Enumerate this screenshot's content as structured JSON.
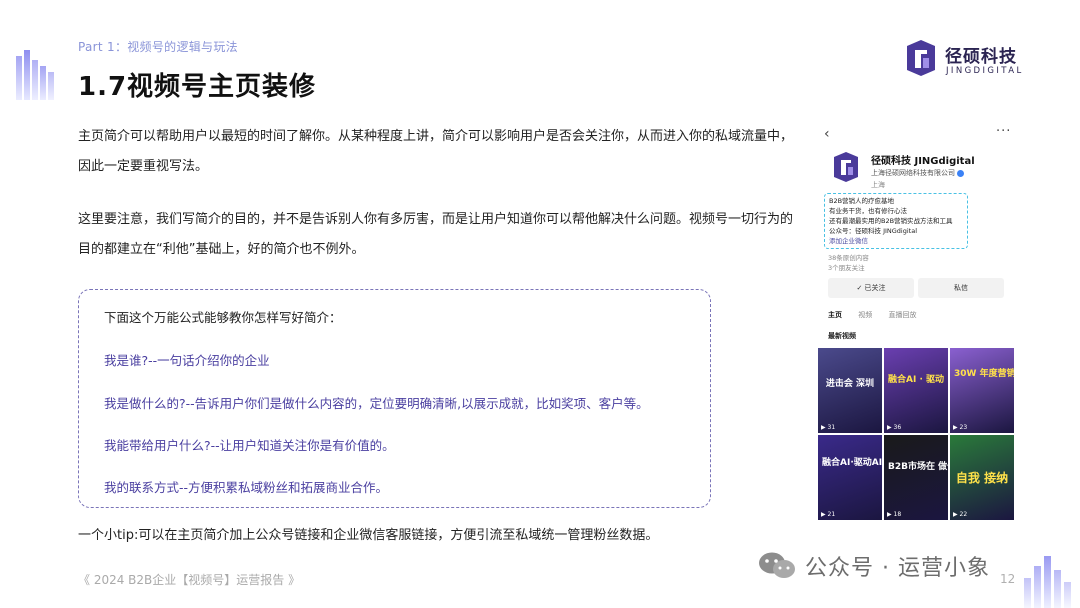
{
  "header": {
    "part_label": "Part 1：视频号的逻辑与玩法",
    "title": "1.7视频号主页装修"
  },
  "logo": {
    "name_cn": "径硕科技",
    "name_en": "JINGDIGITAL",
    "color": "#2b2452"
  },
  "body": {
    "paragraph1": "主页简介可以帮助用户以最短的时间了解你。从某种程度上讲，简介可以影响用户是否会关注你，从而进入你的私域流量中，因此一定要重视写法。",
    "paragraph2": "这里要注意，我们写简介的目的，并不是告诉别人你有多厉害，而是让用户知道你可以帮他解决什么问题。视频号一切行为的目的都建立在“利他”基础上，好的简介也不例外。"
  },
  "formula": {
    "intro": "下面这个万能公式能够教你怎样写好简介：",
    "items": [
      "我是谁?--一句话介绍你的企业",
      "我是做什么的?--告诉用户你们是做什么内容的，定位要明确清晰,以展示成就，比如奖项、客户等。",
      "我能带给用户什么?--让用户知道关注你是有价值的。",
      "我的联系方式--方便积累私域粉丝和拓展商业合作。"
    ],
    "accent_color": "#4a3fa0"
  },
  "tip": "一个小tip:可以在主页简介加上公众号链接和企业微信客服链接，方便引流至私域统一管理粉丝数据。",
  "footer": {
    "report_name": "《 2024 B2B企业【视频号】运营报告 》",
    "page_number": "12"
  },
  "watermark": {
    "text": "公众号 · 运营小象"
  },
  "phone": {
    "back_icon": "‹",
    "more_icon": "···",
    "account_name": "径硕科技 JINGdigital",
    "company": "上海径硕网络科技有限公司",
    "location": "上海",
    "bio_lines": [
      "B2B营销人的疗愈基地",
      "有业务干货，也有修行心法",
      "还有最潮最实用的B2B营销实战方法和工具",
      "公众号：径硕科技 JINGdigital",
      "添加企业微信"
    ],
    "stats": [
      "38条原创内容",
      "3个朋友关注"
    ],
    "follow_button": "✓ 已关注",
    "message_button": "私信",
    "tabs": [
      "主页",
      "视频",
      "直播回放"
    ],
    "section_title": "最新视频",
    "tiles": [
      {
        "text": "进击会 深圳",
        "count": "▶ 31",
        "bg": "#4b4a8c",
        "fg": "#ffffff"
      },
      {
        "text": "融合AI · 驱动",
        "count": "▶ 36",
        "bg": "#6a3fb0",
        "fg": "#ffe14a"
      },
      {
        "text": "30W 年度营销",
        "count": "▶ 23",
        "bg": "#8a60d0",
        "fg": "#ffe14a"
      },
      {
        "text": "融合AI·驱动AI",
        "count": "▶ 21",
        "bg": "#3a2a8a",
        "fg": "#ffffff"
      },
      {
        "text": "B2B市场在 做什么",
        "count": "▶ 18",
        "bg": "#1a1a1a",
        "fg": "#ffffff"
      },
      {
        "text": "自我 接纳",
        "count": "▶ 22",
        "bg": "#2a7a3a",
        "fg": "#ffe14a"
      }
    ]
  }
}
